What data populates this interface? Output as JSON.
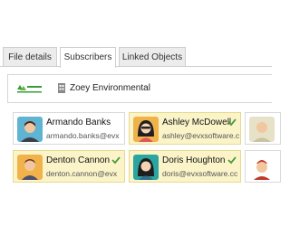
{
  "tabs": [
    {
      "label": "File details",
      "active": false
    },
    {
      "label": "Subscribers",
      "active": true
    },
    {
      "label": "Linked Objects",
      "active": false
    }
  ],
  "organization": {
    "name": "Zoey Environmental",
    "logo_text": "ZOEY ENVIRONMENTAL",
    "icon": "building-icon"
  },
  "subscribers": [
    {
      "name": "Armando Banks",
      "email": "armando.banks@evx",
      "selected": false,
      "avatar": "male-avatar-icon",
      "avatar_bg": "#5fb3d3"
    },
    {
      "name": "Ashley McDowell",
      "email": "ashley@evxsoftware.c",
      "selected": true,
      "avatar": "female-avatar-icon",
      "avatar_bg": "#f1b24a"
    },
    {
      "name": "Denton Cannon",
      "email": "denton.cannon@evx",
      "selected": true,
      "avatar": "male-avatar-icon",
      "avatar_bg": "#f1b24a"
    },
    {
      "name": "Doris Houghton",
      "email": "doris@evxsoftware.cc",
      "selected": true,
      "avatar": "female-avatar-icon",
      "avatar_bg": "#2aa5a0"
    }
  ],
  "colors": {
    "selected_bg": "#fbf4c9",
    "check": "#4e9a3a"
  }
}
